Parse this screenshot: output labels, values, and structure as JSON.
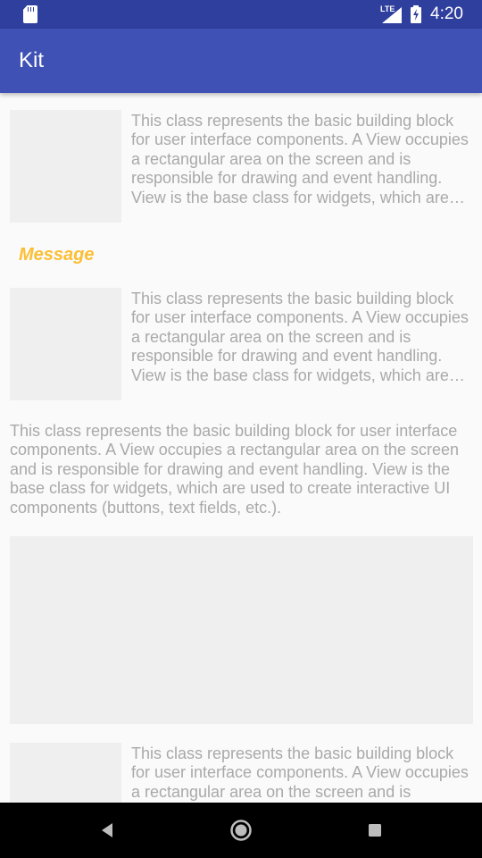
{
  "status_bar": {
    "time": "4:20",
    "network": "LTE",
    "icons": [
      "sd-card-icon",
      "signal-icon",
      "battery-charging-icon"
    ]
  },
  "app_bar": {
    "title": "Kit"
  },
  "content": {
    "items": [
      {
        "text": "This class represents the basic building block for user interface components. A View occupies a rectangular area on the screen and is responsible for drawing and event handling. View is the base class for widgets, which are used to create interactive UI components (buttons, text fields, etc.)."
      }
    ],
    "section_title": "Message",
    "items2": [
      {
        "text": "This class represents the basic building block for user interface components. A View occupies a rectangular area on the screen and is responsible for drawing and event handling. View is the base class for widgets, which are used to create interactive UI components (buttons, text fields, etc.)."
      }
    ],
    "paragraph": "This class represents the basic building block for user interface components. A View occupies a rectangular area on the screen and is responsible for drawing and event handling. View is the base class for widgets, which are used to create interactive UI components (buttons, text fields, etc.).",
    "items3": [
      {
        "text": "This class represents the basic building block for user interface components. A View occupies a rectangular area on the screen and is responsible for drawing and event handling. View is the base class for widgets, which are used to create interactive UI components (buttons, text fields, etc.)."
      }
    ]
  },
  "nav_bar": {
    "buttons": [
      "back-icon",
      "home-icon",
      "recents-icon"
    ]
  },
  "colors": {
    "status_bar": "#2f3f9e",
    "app_bar": "#3f51b5",
    "accent": "#fbbf33",
    "body_text": "#a9a9a9",
    "placeholder": "#efefef"
  }
}
